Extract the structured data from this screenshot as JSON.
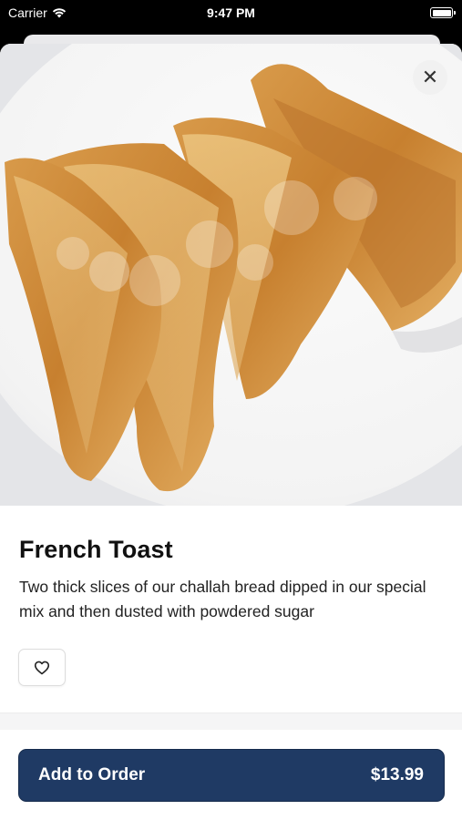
{
  "status_bar": {
    "carrier": "Carrier",
    "time": "9:47 PM"
  },
  "item": {
    "title": "French Toast",
    "description": "Two thick slices of our challah bread dipped in our special mix and then dusted with powdered sugar"
  },
  "actions": {
    "add_to_order_label": "Add to Order",
    "price": "$13.99",
    "close_symbol": "✕"
  },
  "icons": {
    "close": "close-icon",
    "favorite": "heart-icon",
    "wifi": "wifi-icon",
    "battery": "battery-icon"
  },
  "colors": {
    "primary_button": "#1f3a64",
    "text": "#111111",
    "background": "#ffffff"
  }
}
